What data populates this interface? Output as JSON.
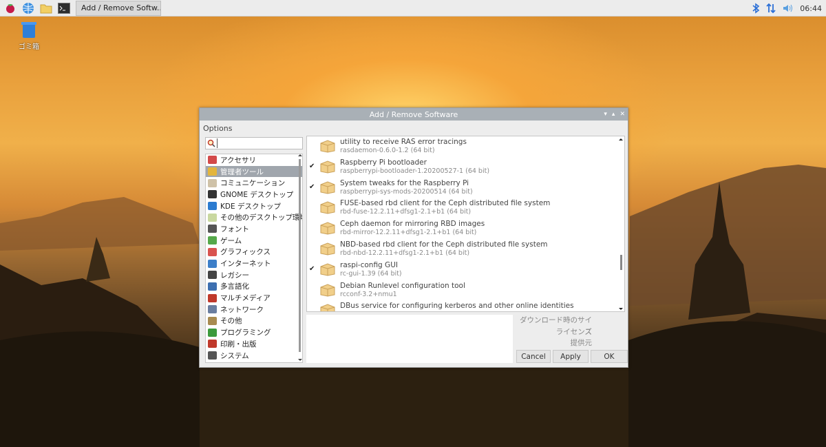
{
  "taskbar": {
    "task_title": "Add / Remove Softw...",
    "clock": "06:44",
    "icons": [
      "raspberry-menu-icon",
      "web-browser-icon",
      "file-manager-icon",
      "terminal-icon"
    ],
    "tray_icons": [
      "bluetooth-icon",
      "network-icon",
      "volume-icon"
    ]
  },
  "desktop": {
    "trash_label": "ゴミ箱"
  },
  "window": {
    "title": "Add / Remove Software",
    "menu": "Options",
    "search": {
      "placeholder": "",
      "value": ""
    },
    "categories": [
      {
        "label": "アクセサリ",
        "icon": "accessories-icon",
        "color": "#d34a4a"
      },
      {
        "label": "管理者ツール",
        "icon": "admin-tools-icon",
        "color": "#e3b53c",
        "selected": true
      },
      {
        "label": "コミュニケーション",
        "icon": "communication-icon",
        "color": "#cfc2a8"
      },
      {
        "label": "GNOME デスクトップ",
        "icon": "gnome-icon",
        "color": "#333333"
      },
      {
        "label": "KDE デスクトップ",
        "icon": "kde-icon",
        "color": "#2b7bd0"
      },
      {
        "label": "その他のデスクトップ環境",
        "icon": "other-desktop-icon",
        "color": "#c9d8a0"
      },
      {
        "label": "フォント",
        "icon": "fonts-icon",
        "color": "#555555"
      },
      {
        "label": "ゲーム",
        "icon": "games-icon",
        "color": "#55a84a"
      },
      {
        "label": "グラフィックス",
        "icon": "graphics-icon",
        "color": "#d9534f"
      },
      {
        "label": "インターネット",
        "icon": "internet-icon",
        "color": "#3d7fc9"
      },
      {
        "label": "レガシー",
        "icon": "legacy-icon",
        "color": "#444444"
      },
      {
        "label": "多言語化",
        "icon": "localization-icon",
        "color": "#3d6fb0"
      },
      {
        "label": "マルチメディア",
        "icon": "multimedia-icon",
        "color": "#c0392b"
      },
      {
        "label": "ネットワーク",
        "icon": "network-cat-icon",
        "color": "#6a7ea0"
      },
      {
        "label": "その他",
        "icon": "other-icon",
        "color": "#a88b50"
      },
      {
        "label": "プログラミング",
        "icon": "programming-icon",
        "color": "#3c9a3c"
      },
      {
        "label": "印刷・出版",
        "icon": "printing-icon",
        "color": "#c0392b"
      },
      {
        "label": "システム",
        "icon": "system-icon",
        "color": "#555555"
      }
    ],
    "packages": [
      {
        "name": "utility to receive RAS error tracings",
        "version": "rasdaemon-0.6.0-1.2 (64 bit)",
        "installed": false
      },
      {
        "name": "Raspberry Pi bootloader",
        "version": "raspberrypi-bootloader-1.20200527-1 (64 bit)",
        "installed": true
      },
      {
        "name": "System tweaks for the Raspberry Pi",
        "version": "raspberrypi-sys-mods-20200514 (64 bit)",
        "installed": true
      },
      {
        "name": "FUSE-based rbd client for the Ceph distributed file system",
        "version": "rbd-fuse-12.2.11+dfsg1-2.1+b1 (64 bit)",
        "installed": false
      },
      {
        "name": "Ceph daemon for mirroring RBD images",
        "version": "rbd-mirror-12.2.11+dfsg1-2.1+b1 (64 bit)",
        "installed": false
      },
      {
        "name": "NBD-based rbd client for the Ceph distributed file system",
        "version": "rbd-nbd-12.2.11+dfsg1-2.1+b1 (64 bit)",
        "installed": false
      },
      {
        "name": "raspi-config GUI",
        "version": "rc-gui-1.39 (64 bit)",
        "installed": true
      },
      {
        "name": "Debian Runlevel configuration tool",
        "version": "rcconf-3.2+nmu1",
        "installed": false
      },
      {
        "name": "DBus service for configuring kerberos and other online identities",
        "version": "",
        "installed": false
      }
    ],
    "info": {
      "download_size_label": "ダウンロード時のサイズ",
      "license_label": "ライセンス",
      "provider_label": "提供元"
    },
    "buttons": {
      "cancel": "Cancel",
      "apply": "Apply",
      "ok": "OK"
    }
  }
}
